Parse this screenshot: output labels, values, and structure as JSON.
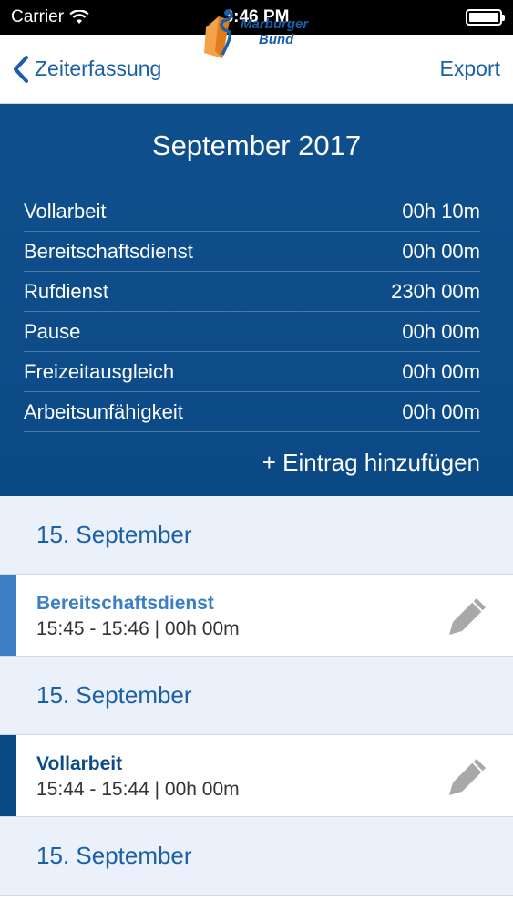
{
  "status_bar": {
    "carrier": "Carrier",
    "time": "3:46 PM"
  },
  "nav": {
    "back_label": "Zeiterfassung",
    "logo_line1": "Marburger",
    "logo_line2": "Bund",
    "export_label": "Export"
  },
  "summary": {
    "month": "September 2017",
    "rows": [
      {
        "label": "Vollarbeit",
        "value": "00h 10m"
      },
      {
        "label": "Bereitschaftsdienst",
        "value": "00h 00m"
      },
      {
        "label": "Rufdienst",
        "value": "230h 00m"
      },
      {
        "label": "Pause",
        "value": "00h 00m"
      },
      {
        "label": "Freizeitausgleich",
        "value": "00h 00m"
      },
      {
        "label": "Arbeitsunfähigkeit",
        "value": "00h 00m"
      }
    ],
    "add_entry": "+ Eintrag hinzufügen"
  },
  "entries": [
    {
      "date": "15. September",
      "title": "Bereitschaftsdienst",
      "time": "15:45 - 15:46 | 00h 00m",
      "color": "#3d7fc4"
    },
    {
      "date": "15. September",
      "title": "Vollarbeit",
      "time": "15:44 - 15:44 | 00h 00m",
      "color": "#0c4a86"
    },
    {
      "date": "15. September"
    }
  ],
  "colors": {
    "accent": "#1a5fa8",
    "header_bg": "#0f4f8d",
    "date_bg": "#eaf1fa"
  }
}
